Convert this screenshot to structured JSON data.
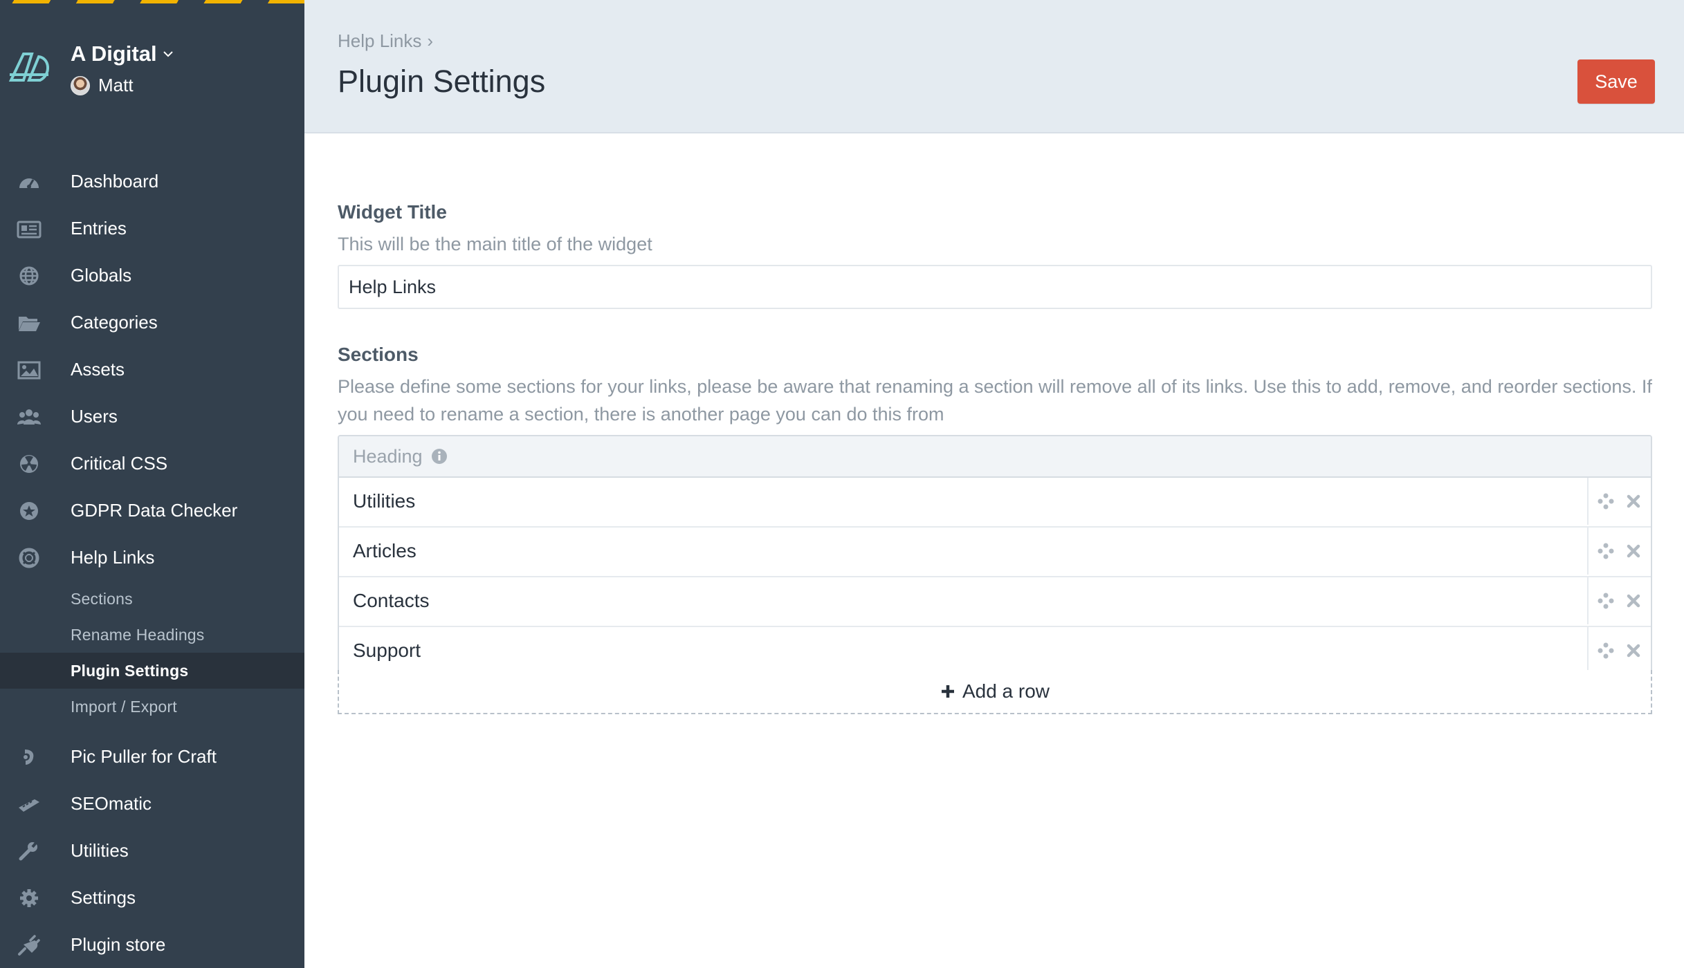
{
  "site": {
    "name": "A Digital",
    "user": "Matt"
  },
  "nav": {
    "items": [
      {
        "label": "Dashboard",
        "icon": "dashboard-icon"
      },
      {
        "label": "Entries",
        "icon": "entries-icon"
      },
      {
        "label": "Globals",
        "icon": "globe-icon"
      },
      {
        "label": "Categories",
        "icon": "folder-icon"
      },
      {
        "label": "Assets",
        "icon": "image-icon"
      },
      {
        "label": "Users",
        "icon": "users-icon"
      },
      {
        "label": "Critical CSS",
        "icon": "radiation-icon"
      },
      {
        "label": "GDPR Data Checker",
        "icon": "star-badge-icon"
      },
      {
        "label": "Help Links",
        "icon": "lifebuoy-icon"
      }
    ],
    "help_links_subnav": [
      "Sections",
      "Rename Headings",
      "Plugin Settings",
      "Import / Export"
    ],
    "active_subnav": "Plugin Settings",
    "bottom_items": [
      {
        "label": "Pic Puller for Craft",
        "icon": "pic-puller-icon"
      },
      {
        "label": "SEOmatic",
        "icon": "seomatic-icon"
      },
      {
        "label": "Utilities",
        "icon": "wrench-icon"
      },
      {
        "label": "Settings",
        "icon": "gear-icon"
      },
      {
        "label": "Plugin store",
        "icon": "plug-icon"
      }
    ]
  },
  "header": {
    "breadcrumb": "Help Links",
    "title": "Plugin Settings",
    "save_label": "Save"
  },
  "widget_title": {
    "label": "Widget Title",
    "instructions": "This will be the main title of the widget",
    "value": "Help Links"
  },
  "sections": {
    "label": "Sections",
    "instructions": "Please define some sections for your links, please be aware that renaming a section will remove all of its links. Use this to add, remove, and reorder sections. If you need to rename a section, there is another page you can do this from",
    "column_heading": "Heading",
    "rows": [
      "Utilities",
      "Articles",
      "Contacts",
      "Support"
    ],
    "add_row_label": "Add a row"
  },
  "colors": {
    "sidebar_bg": "#33404d",
    "active_nav_bg": "#29323c",
    "header_bg": "#e4ebf1",
    "save_button": "#d9513c",
    "stripe": "#f2b300"
  }
}
